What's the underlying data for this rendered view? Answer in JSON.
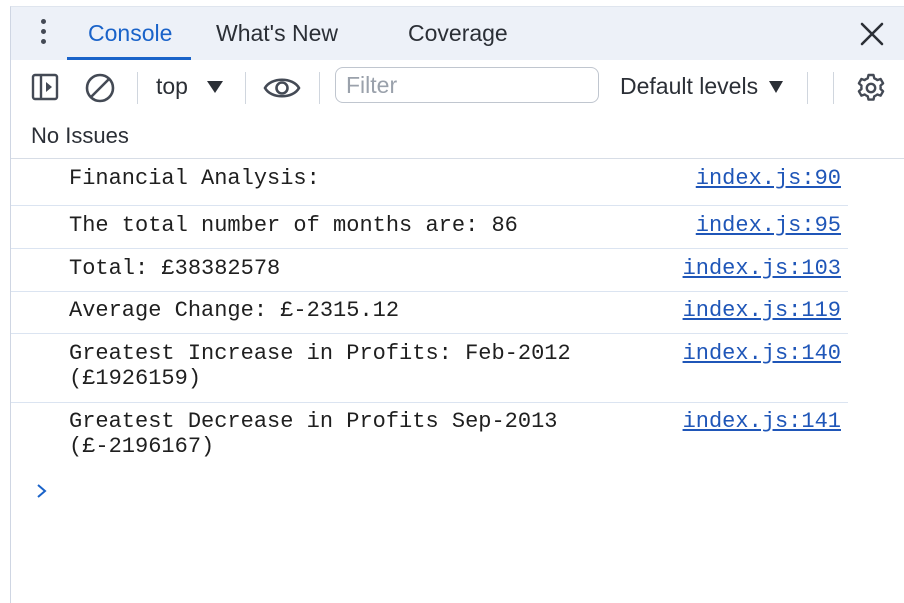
{
  "tabs": [
    {
      "label": "Console",
      "active": true
    },
    {
      "label": "What's New",
      "active": false
    },
    {
      "label": "Coverage",
      "active": false
    }
  ],
  "toolbar": {
    "context": "top",
    "filter_placeholder": "Filter",
    "filter_value": "",
    "levels_label": "Default levels"
  },
  "issues": {
    "text": "No Issues"
  },
  "messages": [
    {
      "lines": "Financial Analysis:",
      "source": "index.js:90"
    },
    {
      "lines": "The total number of months are: 86",
      "source": "index.js:95"
    },
    {
      "lines": "Total: £38382578",
      "source": "index.js:103"
    },
    {
      "lines": "Average Change: £-2315.12",
      "source": "index.js:119"
    },
    {
      "lines": "Greatest Increase in Profits: Feb-2012\n(£1926159)",
      "source": "index.js:140"
    },
    {
      "lines": "Greatest Decrease in Profits Sep-2013\n(£-2196167)",
      "source": "index.js:141"
    }
  ],
  "icons": {
    "menu": "kebab-menu-icon",
    "close": "close-icon",
    "sidebar": "sidebar-toggle-icon",
    "clear": "clear-console-icon",
    "eye": "live-expression-icon",
    "settings": "gear-icon",
    "prompt": "chevron-right-icon"
  },
  "colors": {
    "accent": "#1a63c9",
    "link": "#1f56b8",
    "tabbar_bg": "#edf1f8"
  }
}
